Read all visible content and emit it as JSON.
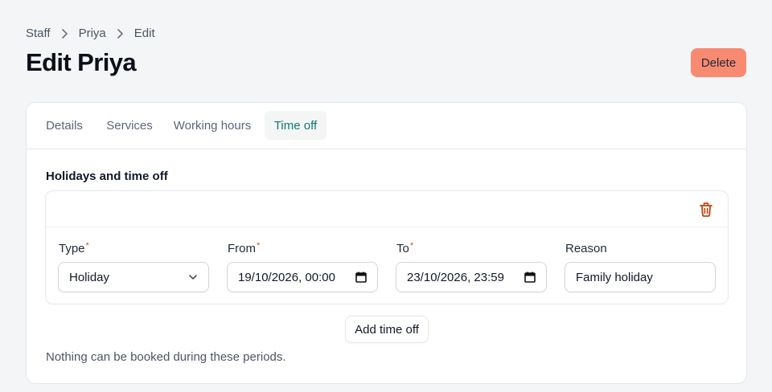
{
  "breadcrumb": {
    "items": [
      "Staff",
      "Priya",
      "Edit"
    ]
  },
  "page": {
    "title": "Edit Priya",
    "delete_label": "Delete"
  },
  "tabs": [
    {
      "label": "Details"
    },
    {
      "label": "Services"
    },
    {
      "label": "Working hours"
    },
    {
      "label": "Time off",
      "active": true
    }
  ],
  "time_off": {
    "heading": "Holidays and time off",
    "entry": {
      "type_label": "Type",
      "type_value": "Holiday",
      "from_label": "From",
      "from_value": "19/10/2026, 00:00",
      "to_label": "To",
      "to_value": "23/10/2026, 23:59",
      "reason_label": "Reason",
      "reason_value": "Family holiday",
      "required_mark": "*"
    },
    "add_label": "Add time off",
    "help_text": "Nothing can be booked during these periods."
  },
  "colors": {
    "accent": "#0f766e",
    "danger": "#f98a72",
    "trash": "#c2410c",
    "required": "#dc4a2e"
  },
  "icons": [
    "chevron-right-icon",
    "trash-icon",
    "chevron-down-icon",
    "calendar-icon"
  ]
}
